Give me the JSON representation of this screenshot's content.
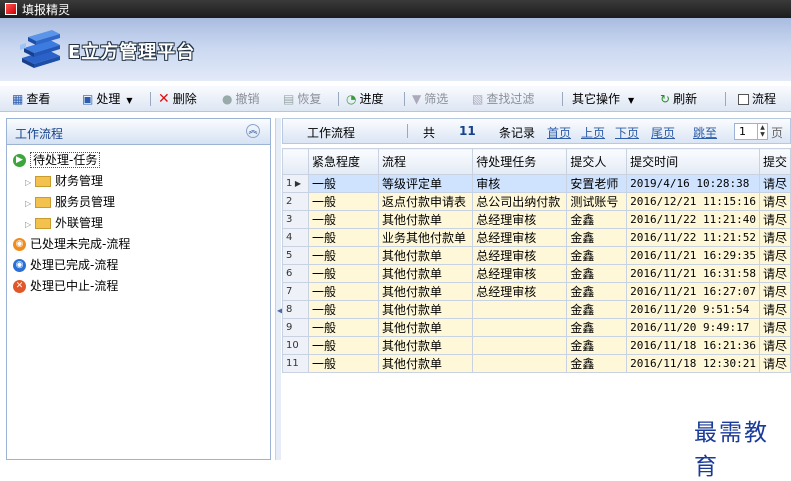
{
  "window": {
    "title": "填报精灵"
  },
  "app": {
    "title": "E立方管理平台"
  },
  "toolbar": {
    "view": "查看",
    "process": "处理",
    "delete": "删除",
    "revoke": "撤销",
    "restore": "恢复",
    "progress": "进度",
    "filter": "筛选",
    "search_filter": "查找过滤",
    "other_ops": "其它操作",
    "refresh": "刷新",
    "flow": "流程"
  },
  "left_panel": {
    "title": "工作流程",
    "items": [
      {
        "label": "待处理-任务"
      },
      {
        "label": "财务管理"
      },
      {
        "label": "服务员管理"
      },
      {
        "label": "外联管理"
      },
      {
        "label": "已处理未完成-流程"
      },
      {
        "label": "处理已完成-流程"
      },
      {
        "label": "处理已中止-流程"
      }
    ]
  },
  "grid_toolbar": {
    "title": "工作流程",
    "total_prefix": "共",
    "total_count": "11",
    "total_suffix": "条记录",
    "first": "首页",
    "prev": "上页",
    "next": "下页",
    "last": "尾页",
    "jump": "跳至",
    "page_value": "1",
    "page_suffix": "页"
  },
  "table": {
    "columns": [
      "紧急程度",
      "流程",
      "待处理任务",
      "提交人",
      "提交时间",
      "提交"
    ],
    "rows": [
      {
        "n": "1",
        "urgency": "一般",
        "flow": "等级评定单",
        "task": "审核",
        "submitter": "安置老师",
        "time": "2019/4/16 10:28:38",
        "extra": "请尽"
      },
      {
        "n": "2",
        "urgency": "一般",
        "flow": "返点付款申请表",
        "task": "总公司出纳付款",
        "submitter": "测试账号",
        "time": "2016/12/21 11:15:16",
        "extra": "请尽"
      },
      {
        "n": "3",
        "urgency": "一般",
        "flow": "其他付款单",
        "task": "总经理审核",
        "submitter": "金鑫",
        "time": "2016/11/22 11:21:40",
        "extra": "请尽"
      },
      {
        "n": "4",
        "urgency": "一般",
        "flow": "业务其他付款单",
        "task": "总经理审核",
        "submitter": "金鑫",
        "time": "2016/11/22 11:21:52",
        "extra": "请尽"
      },
      {
        "n": "5",
        "urgency": "一般",
        "flow": "其他付款单",
        "task": "总经理审核",
        "submitter": "金鑫",
        "time": "2016/11/21 16:29:35",
        "extra": "请尽"
      },
      {
        "n": "6",
        "urgency": "一般",
        "flow": "其他付款单",
        "task": "总经理审核",
        "submitter": "金鑫",
        "time": "2016/11/21 16:31:58",
        "extra": "请尽"
      },
      {
        "n": "7",
        "urgency": "一般",
        "flow": "其他付款单",
        "task": "总经理审核",
        "submitter": "金鑫",
        "time": "2016/11/21 16:27:07",
        "extra": "请尽"
      },
      {
        "n": "8",
        "urgency": "一般",
        "flow": "其他付款单",
        "task": "",
        "submitter": "金鑫",
        "time": "2016/11/20 9:51:54",
        "extra": "请尽"
      },
      {
        "n": "9",
        "urgency": "一般",
        "flow": "其他付款单",
        "task": "",
        "submitter": "金鑫",
        "time": "2016/11/20 9:49:17",
        "extra": "请尽"
      },
      {
        "n": "10",
        "urgency": "一般",
        "flow": "其他付款单",
        "task": "",
        "submitter": "金鑫",
        "time": "2016/11/18 16:21:36",
        "extra": "请尽"
      },
      {
        "n": "11",
        "urgency": "一般",
        "flow": "其他付款单",
        "task": "",
        "submitter": "金鑫",
        "time": "2016/11/18 12:30:21",
        "extra": "请尽"
      }
    ]
  },
  "watermark": "最需教育"
}
